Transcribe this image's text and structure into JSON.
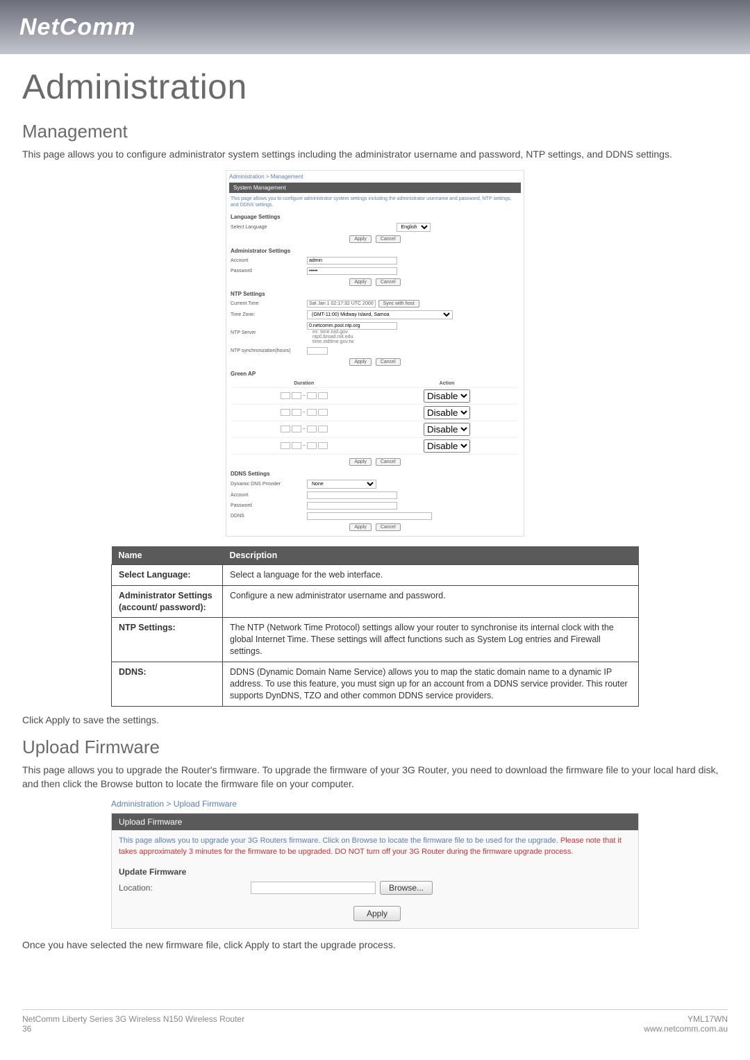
{
  "logo": "NetComm",
  "title": "Administration",
  "management": {
    "heading": "Management",
    "intro": "This page allows you to configure administrator system settings including the administrator username and password, NTP settings, and DDNS settings.",
    "shot": {
      "breadcrumb": "Administration > Management",
      "panel_title": "System Management",
      "panel_desc": "This page allows you to configure administrator system settings including the administrator username and password, NTP settings, and DDNS settings.",
      "lang_hdr": "Language Settings",
      "lang_lbl": "Select Language",
      "lang_val": "English",
      "admin_hdr": "Administrator Settings",
      "account_lbl": "Account",
      "account_val": "admin",
      "password_lbl": "Password",
      "password_val": "•••••",
      "ntp_hdr": "NTP Settings",
      "curtime_lbl": "Current Time",
      "curtime_val": "Sat Jan  1 02:17:32 UTC 2000",
      "sync_btn": "Sync with host",
      "tz_lbl": "Time Zone:",
      "tz_val": "(GMT-11:00) Midway Island, Samoa",
      "ntpserver_lbl": "NTP Server",
      "ntpserver_val": "0.netcomm.pool.ntp.org",
      "ntp_hints": [
        "ex: time.nist.gov",
        "ntp0.broad.mit.edu",
        "time.stdtime.gov.tw"
      ],
      "ntpsync_lbl": "NTP synchronization(hours)",
      "greenap_hdr": "Green AP",
      "greenap_cols": [
        "Duration",
        "Action"
      ],
      "greenap_rows": 4,
      "greenap_action": "Disable",
      "ddns_hdr": "DDNS Settings",
      "ddnsprov_lbl": "Dynamic DNS Provider",
      "ddnsprov_val": "None",
      "ddnsacc_lbl": "Account",
      "ddnspwd_lbl": "Password",
      "ddnsname_lbl": "DDNS",
      "apply": "Apply",
      "cancel": "Cancel"
    },
    "table": {
      "hdr_name": "Name",
      "hdr_desc": "Description",
      "rows": [
        {
          "k": "Select Language:",
          "v": "Select a language for the web interface."
        },
        {
          "k": "Administrator Settings (account/ password):",
          "v": "Configure a new administrator username and password."
        },
        {
          "k": "NTP Settings:",
          "v": "The NTP (Network Time Protocol) settings allow your router to synchronise its internal clock with the global Internet Time. These settings will affect functions such as System Log entries and Firewall settings."
        },
        {
          "k": "DDNS:",
          "v": "DDNS (Dynamic Domain Name Service) allows you to map the static domain name to a dynamic IP address. To use this feature, you must sign up for an account from a DDNS service provider. This router supports DynDNS, TZO and other common DDNS service providers."
        }
      ]
    },
    "apply_note": "Click Apply to save the settings."
  },
  "upload": {
    "heading": "Upload Firmware",
    "intro": "This page allows you to upgrade the Router's firmware. To upgrade the firmware of your 3G Router, you need to download the firmware file to your local hard disk, and then click the Browse button to locate the firmware file on your computer.",
    "shot": {
      "breadcrumb": "Administration > Upload Firmware",
      "panel_title": "Upload Firmware",
      "desc_lead": "This page allows you to upgrade your 3G Routers firmware. Click on Browse to locate the firmware file to be used for the upgrade.",
      "desc_warn": "Please note that it takes approximately 3 minutes for the firmware to be upgraded. DO NOT turn off your 3G Router during the firmware upgrade process.",
      "update_hdr": "Update Firmware",
      "location_lbl": "Location:",
      "browse_btn": "Browse...",
      "apply_btn": "Apply"
    },
    "after": "Once you have selected the new firmware file, click Apply to start the upgrade process."
  },
  "footer": {
    "left1": "NetComm Liberty Series 3G Wireless N150 Wireless Router",
    "left2": "36",
    "right1": "YML17WN",
    "right2": "www.netcomm.com.au"
  }
}
